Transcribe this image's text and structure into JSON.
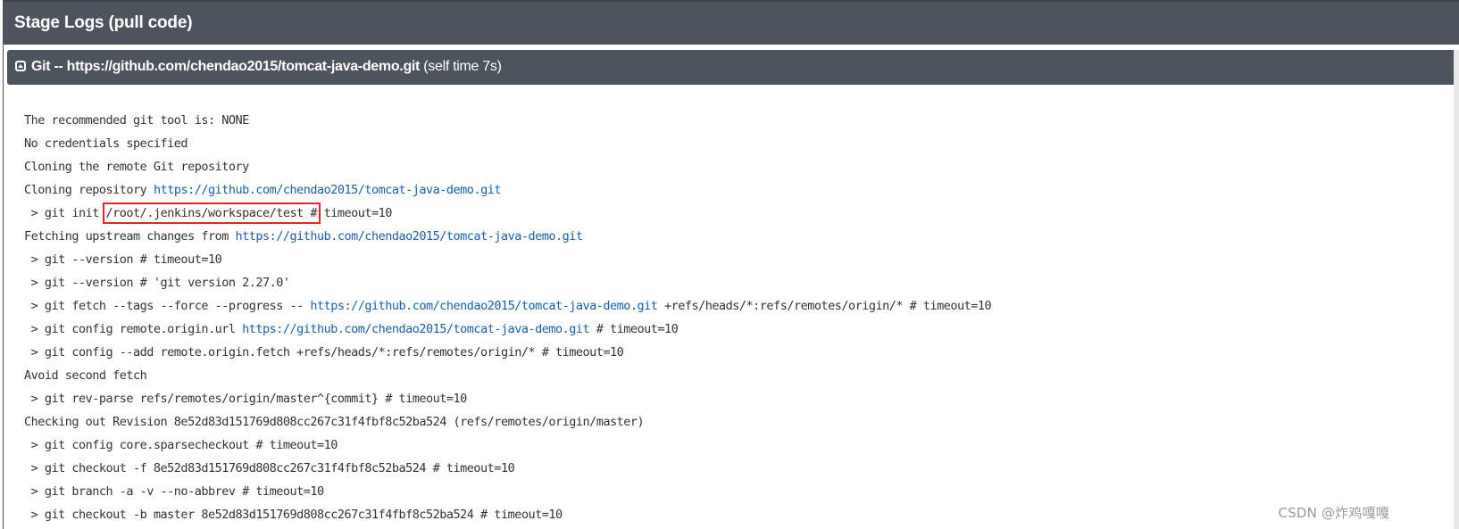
{
  "stage": {
    "title": "Stage Logs (pull code)"
  },
  "step": {
    "icon": "collapse-square-icon",
    "label": "Git -- https://github.com/chendao2015/tomcat-java-demo.git",
    "self_time": "(self time 7s)"
  },
  "log": {
    "repo_url": "https://github.com/chendao2015/tomcat-java-demo.git",
    "highlighted_path": "/root/.jenkins/workspace/test #",
    "highlight_color": "#e0262a",
    "link_color": "#1a5fa8",
    "lines": [
      "The recommended git tool is: NONE",
      "No credentials specified",
      "Cloning the remote Git repository",
      "Cloning repository ",
      " > git init ",
      " timeout=10",
      "Fetching upstream changes from ",
      " > git --version # timeout=10",
      " > git --version # 'git version 2.27.0'",
      " > git fetch --tags --force --progress -- ",
      " +refs/heads/*:refs/remotes/origin/* # timeout=10",
      " > git config remote.origin.url ",
      " # timeout=10",
      " > git config --add remote.origin.fetch +refs/heads/*:refs/remotes/origin/* # timeout=10",
      "Avoid second fetch",
      " > git rev-parse refs/remotes/origin/master^{commit} # timeout=10",
      "Checking out Revision 8e52d83d151769d808cc267c31f4fbf8c52ba524 (refs/remotes/origin/master)",
      " > git config core.sparsecheckout # timeout=10",
      " > git checkout -f 8e52d83d151769d808cc267c31f4fbf8c52ba524 # timeout=10",
      " > git branch -a -v --no-abbrev # timeout=10",
      " > git checkout -b master 8e52d83d151769d808cc267c31f4fbf8c52ba524 # timeout=10"
    ]
  },
  "watermark": "CSDN @炸鸡嘎嘎",
  "colors": {
    "header_bg": "#4e545d",
    "header_text": "#ffffff",
    "log_text": "#333333"
  }
}
